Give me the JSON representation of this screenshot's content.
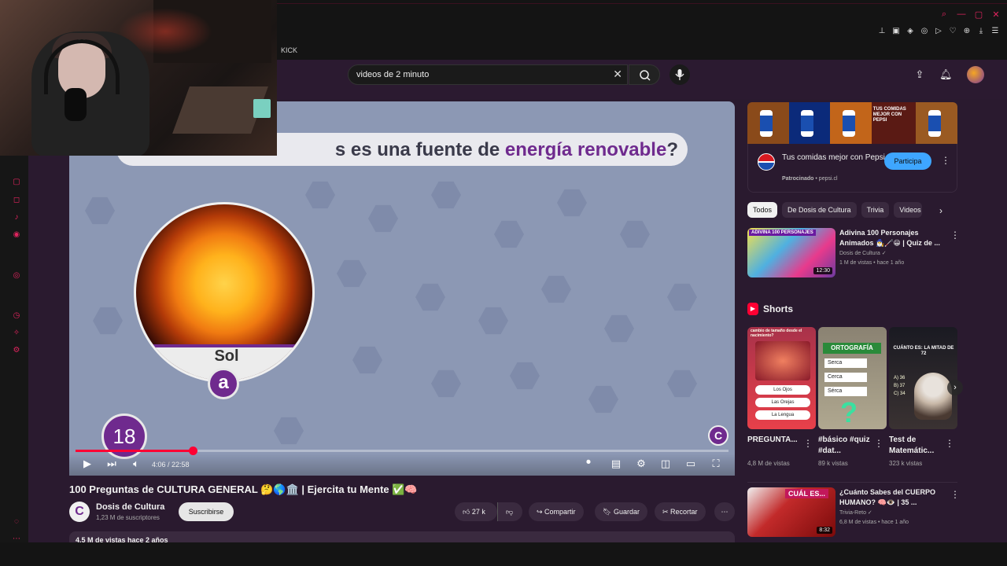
{
  "browser": {
    "tab_label": "KICK",
    "colors": {
      "accent": "#e0245e",
      "chrome_bg": "#141414"
    }
  },
  "header": {
    "search_value": "videos de 2 minuto",
    "icons": [
      "clear-icon",
      "search-icon",
      "mic-icon",
      "upload-icon",
      "bell-icon"
    ]
  },
  "player": {
    "question_prefix": "s es una fuente de ",
    "question_highlight": "energía renovable",
    "question_suffix": "?",
    "answer_label": "Sol",
    "option_letter": "a",
    "question_number": "18",
    "watermark": "C",
    "time_display": "4:06 / 22:58",
    "progress": 0.18,
    "colors": {
      "accent": "#6f2a8e",
      "progress": "#ff0033"
    }
  },
  "video": {
    "title": "100 Preguntas de CULTURA GENERAL 🤔🌎🏛️ | Ejercita tu Mente ✅🧠",
    "channel_name": "Dosis de Cultura",
    "channel_initial": "C",
    "subscribers": "1,23 M de suscriptores",
    "subscribe_label": "Suscribirse",
    "likes": "27 k",
    "share_label": "Compartir",
    "save_label": "Guardar",
    "clip_label": "Recortar",
    "more_label": "⋯",
    "desc_summary": "4,5 M de vistas  hace 2 años"
  },
  "ad": {
    "title": "Tus comidas mejor con Pepsi",
    "sponsored": "Patrocinado",
    "domain": "pepsi.cl",
    "cta": "Participa",
    "banner_text": "TUS COMIDAS MEJOR CON PEPSI"
  },
  "chips": [
    "Todos",
    "De Dosis de Cultura",
    "Trivia",
    "Videos"
  ],
  "recommendations": [
    {
      "title": "Adivina 100 Personajes Animados 🧙‍♂️🦯😀 | Quiz de ...",
      "channel": "Dosis de Cultura ✓",
      "meta": "1 M de vistas • hace 1 año",
      "duration": "12:30",
      "thumb_text": "ADIVINA 100 PERSONAJES"
    },
    {
      "title": "¿Cuánto Sabes del CUERPO HUMANO? 🧠👁️ | 35 ...",
      "channel": "Trivia-Reto ✓",
      "meta": "6,8 M de vistas • hace 1 año",
      "duration": "8:32",
      "thumb_text": "CUÁL ES..."
    }
  ],
  "shorts": {
    "header": "Shorts",
    "items": [
      {
        "title": "PREGUNTA...",
        "views": "4,8 M de vistas",
        "thumb_caption": "cambio de tamaño desde el nacimiento?",
        "opts": [
          "Los Ojos",
          "Las Orejas",
          "La Lengua"
        ]
      },
      {
        "title": "#básico #quiz #dat...",
        "views": "89 k vistas",
        "thumb_caption": "ORTOGRAFÍA",
        "opts": [
          "Serca",
          "Cerca",
          "Sérca"
        ]
      },
      {
        "title": "Test de Matemátic...",
        "views": "323 k vistas",
        "thumb_caption": "CUÁNTO ES: LA MITAD DE 72",
        "opts": [
          "A) 36",
          "B) 37",
          "C) 34"
        ]
      }
    ]
  }
}
